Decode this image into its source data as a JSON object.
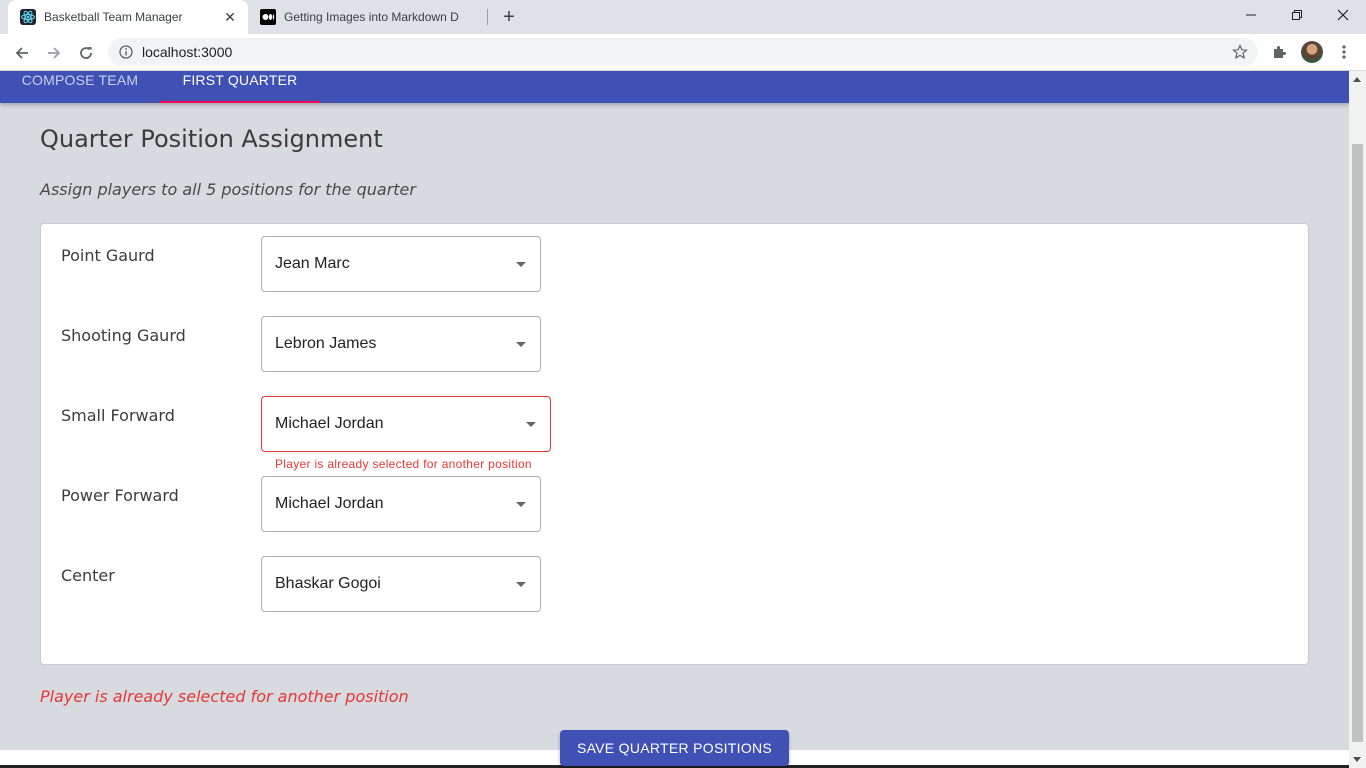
{
  "browser": {
    "tabs": [
      {
        "title": "Basketball Team Manager",
        "icon": "react-icon",
        "active": true
      },
      {
        "title": "Getting Images into Markdown D",
        "icon": "medium-icon",
        "active": false
      }
    ],
    "url": "localhost:3000"
  },
  "app": {
    "nav_tabs": [
      {
        "label": "COMPOSE TEAM"
      },
      {
        "label": "FIRST QUARTER"
      }
    ],
    "active_tab": 1,
    "accent_color": "#3f51b5",
    "indicator_color": "#f50057",
    "error_color": "#e53935"
  },
  "page": {
    "title": "Quarter Position Assignment",
    "subtitle": "Assign players to all 5 positions for the quarter"
  },
  "positions": [
    {
      "label": "Point Gaurd",
      "player": "Jean Marc"
    },
    {
      "label": "Shooting Gaurd",
      "player": "Lebron James"
    },
    {
      "label": "Small Forward",
      "player": "Michael Jordan",
      "error": "Player is already selected for another position"
    },
    {
      "label": "Power Forward",
      "player": "Michael Jordan"
    },
    {
      "label": "Center",
      "player": "Bhaskar Gogoi"
    }
  ],
  "form_error": "Player is already selected for another position",
  "save_button": "SAVE QUARTER POSITIONS"
}
